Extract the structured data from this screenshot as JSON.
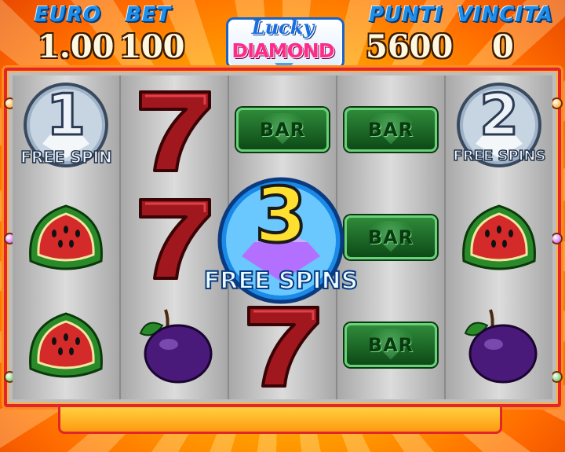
{
  "hud": {
    "euro_label": "EURO",
    "euro_value": "1.00",
    "bet_label": "BET",
    "bet_value": "100",
    "punti_label": "PUNTI",
    "punti_value": "5600",
    "vincita_label": "VINCITA",
    "vincita_value": "0"
  },
  "logo": {
    "line1": "Lucky",
    "line2": "DIAMOND"
  },
  "reels": [
    {
      "symbols": [
        "free-spin-badge-1",
        "watermelon",
        "watermelon"
      ]
    },
    {
      "symbols": [
        "seven",
        "seven",
        "plum"
      ]
    },
    {
      "symbols": [
        "bar",
        "free-spin-badge-3",
        "seven"
      ]
    },
    {
      "symbols": [
        "bar",
        "bar",
        "bar"
      ]
    },
    {
      "symbols": [
        "free-spin-badge-2",
        "watermelon",
        "plum"
      ]
    }
  ],
  "free_spin_badges": {
    "badge1": {
      "number": "1",
      "text": "FREE SPIN"
    },
    "badge2": {
      "number": "2",
      "text": "FREE SPINS"
    },
    "badge3": {
      "number": "3",
      "text": "FREE SPINS"
    }
  },
  "bar_label": "BAR",
  "colors": {
    "label_blue": "#1e8ee8",
    "frame_red": "#e0262a",
    "bar_green": "#2f8a3a"
  }
}
